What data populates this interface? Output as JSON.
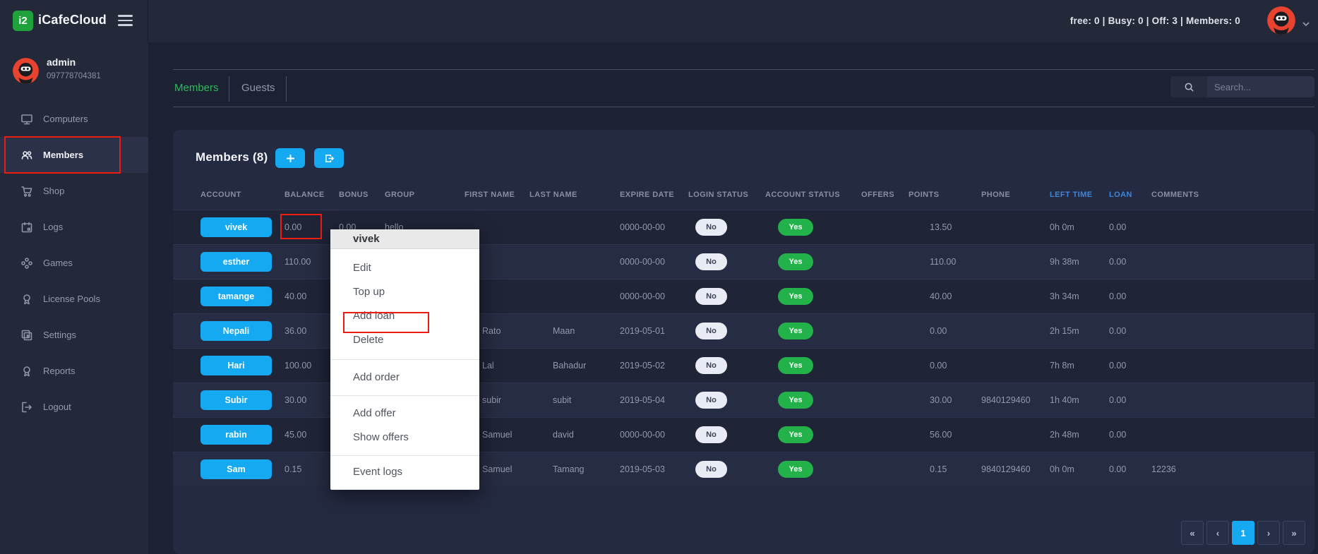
{
  "topbar": {
    "logo_glyph": "i2",
    "brand": "iCafeCloud",
    "status_text": "free: 0  |  Busy: 0  |  Off: 3  |  Members: 0"
  },
  "sidebar": {
    "user_name": "admin",
    "user_phone": "097778704381",
    "items": [
      {
        "label": "Computers",
        "icon": "monitor-icon",
        "active": false
      },
      {
        "label": "Members",
        "icon": "members-icon",
        "active": true
      },
      {
        "label": "Shop",
        "icon": "cart-icon",
        "active": false
      },
      {
        "label": "Logs",
        "icon": "calendar-icon",
        "active": false
      },
      {
        "label": "Games",
        "icon": "games-icon",
        "active": false
      },
      {
        "label": "License Pools",
        "icon": "award-icon",
        "active": false
      },
      {
        "label": "Settings",
        "icon": "layers-icon",
        "active": false
      },
      {
        "label": "Reports",
        "icon": "award-icon",
        "active": false
      },
      {
        "label": "Logout",
        "icon": "logout-icon",
        "active": false
      }
    ]
  },
  "tabs": [
    {
      "label": "Members",
      "active": true
    },
    {
      "label": "Guests",
      "active": false
    }
  ],
  "search": {
    "placeholder": "Search..."
  },
  "panel": {
    "title": "Members",
    "count": "(8)"
  },
  "table": {
    "columns": [
      "ACCOUNT",
      "BALANCE",
      "BONUS",
      "GROUP",
      "FIRST NAME",
      "LAST NAME",
      "EXPIRE DATE",
      "LOGIN STATUS",
      "ACCOUNT STATUS",
      "OFFERS",
      "POINTS",
      "PHONE",
      "LEFT TIME",
      "LOAN",
      "COMMENTS"
    ],
    "rows": [
      {
        "account": "vivek",
        "balance": "0.00",
        "bonus": "0.00",
        "group": "hello",
        "first": "",
        "last": "",
        "expire": "0000-00-00",
        "login": "No",
        "status": "Yes",
        "offers": "",
        "points": "13.50",
        "phone": "",
        "left": "0h 0m",
        "loan": "0.00",
        "comments": ""
      },
      {
        "account": "esther",
        "balance": "110.00",
        "bonus": "",
        "group": "",
        "first": "",
        "last": "",
        "expire": "0000-00-00",
        "login": "No",
        "status": "Yes",
        "offers": "",
        "points": "110.00",
        "phone": "",
        "left": "9h 38m",
        "loan": "0.00",
        "comments": ""
      },
      {
        "account": "tamange",
        "balance": "40.00",
        "bonus": "",
        "group": "",
        "first": "",
        "last": "",
        "expire": "0000-00-00",
        "login": "No",
        "status": "Yes",
        "offers": "",
        "points": "40.00",
        "phone": "",
        "left": "3h 34m",
        "loan": "0.00",
        "comments": ""
      },
      {
        "account": "Nepali",
        "balance": "36.00",
        "bonus": "",
        "group": "",
        "first": "Rato",
        "last": "Maan",
        "expire": "2019-05-01",
        "login": "No",
        "status": "Yes",
        "offers": "",
        "points": "0.00",
        "phone": "",
        "left": "2h 15m",
        "loan": "0.00",
        "comments": ""
      },
      {
        "account": "Hari",
        "balance": "100.00",
        "bonus": "",
        "group": "",
        "first": "Lal",
        "last": "Bahadur",
        "expire": "2019-05-02",
        "login": "No",
        "status": "Yes",
        "offers": "",
        "points": "0.00",
        "phone": "",
        "left": "7h 8m",
        "loan": "0.00",
        "comments": ""
      },
      {
        "account": "Subir",
        "balance": "30.00",
        "bonus": "",
        "group": "",
        "first": "subir",
        "last": "subit",
        "expire": "2019-05-04",
        "login": "No",
        "status": "Yes",
        "offers": "",
        "points": "30.00",
        "phone": "9840129460",
        "left": "1h 40m",
        "loan": "0.00",
        "comments": ""
      },
      {
        "account": "rabin",
        "balance": "45.00",
        "bonus": "",
        "group": "",
        "first": "Samuel",
        "last": "david",
        "expire": "0000-00-00",
        "login": "No",
        "status": "Yes",
        "offers": "",
        "points": "56.00",
        "phone": "",
        "left": "2h 48m",
        "loan": "0.00",
        "comments": ""
      },
      {
        "account": "Sam",
        "balance": "0.15",
        "bonus": "",
        "group": "",
        "first": "Samuel",
        "last": "Tamang",
        "expire": "2019-05-03",
        "login": "No",
        "status": "Yes",
        "offers": "",
        "points": "0.15",
        "phone": "9840129460",
        "left": "0h 0m",
        "loan": "0.00",
        "comments": "12236"
      }
    ]
  },
  "context_menu": {
    "header": "vivek",
    "groups": [
      [
        "Edit",
        "Top up",
        "Add loan",
        "Delete"
      ],
      [
        "Add order"
      ],
      [
        "Add offer",
        "Show offers"
      ],
      [
        "Event logs"
      ]
    ],
    "highlighted_item": "Add loan"
  },
  "pagination": {
    "items": [
      "«",
      "‹",
      "1",
      "›",
      "»"
    ],
    "active": "1"
  },
  "colors": {
    "accent_blue": "#14a9f1",
    "green": "#23b149",
    "tab_green": "#2dbd59",
    "annotation_red": "#ec1c12"
  }
}
